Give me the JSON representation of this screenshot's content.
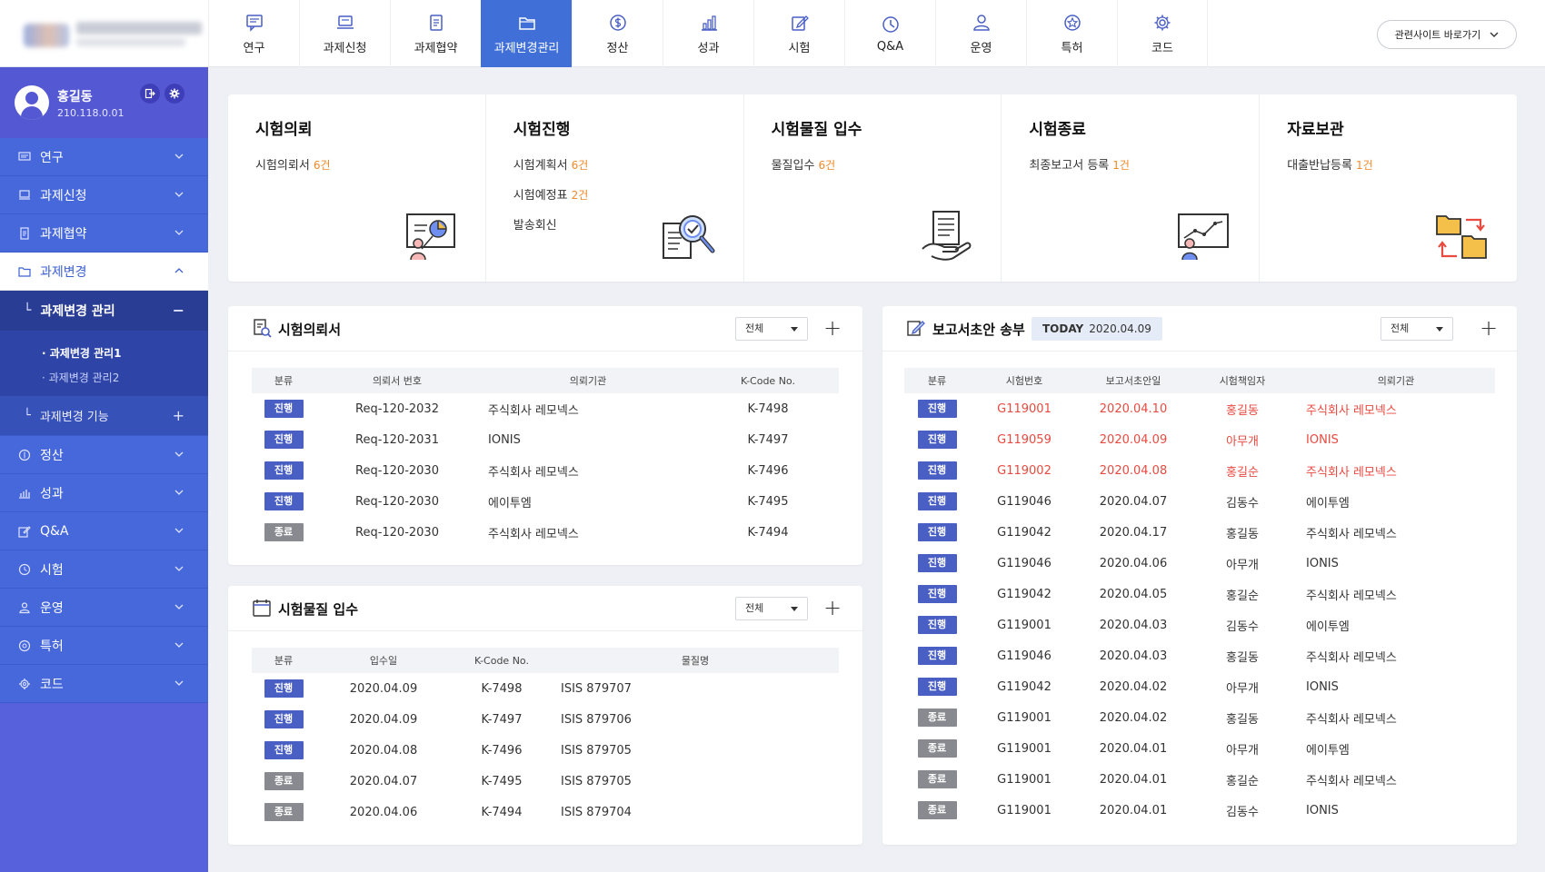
{
  "nav": [
    {
      "label": "연구",
      "icon": "chat-icon"
    },
    {
      "label": "과제신청",
      "icon": "laptop-icon"
    },
    {
      "label": "과제협약",
      "icon": "document-icon"
    },
    {
      "label": "과제변경관리",
      "icon": "folder-icon",
      "active": true
    },
    {
      "label": "정산",
      "icon": "dollar-icon"
    },
    {
      "label": "성과",
      "icon": "bar-chart-icon"
    },
    {
      "label": "시험",
      "icon": "edit-icon"
    },
    {
      "label": "Q&A",
      "icon": "clock-icon"
    },
    {
      "label": "운영",
      "icon": "person-icon"
    },
    {
      "label": "특허",
      "icon": "star-icon"
    },
    {
      "label": "코드",
      "icon": "gear-icon"
    }
  ],
  "related_site": "관련사이트 바로가기",
  "user": {
    "name": "홍길동",
    "ip": "210.118.0.01"
  },
  "sidebar": {
    "top_items": [
      "연구",
      "과제신청",
      "과제협약"
    ],
    "open_item": "과제변경",
    "sub_head": "과제변경 관리",
    "sub_items": [
      "과제변경 관리1",
      "과제변경 관리2"
    ],
    "sub_head2": "과제변경 기능",
    "bottom_items": [
      "정산",
      "성과",
      "Q&A",
      "시험",
      "운영",
      "특허",
      "코드"
    ]
  },
  "summary": [
    {
      "title": "시험의뢰",
      "lines": [
        {
          "label": "시험의뢰서",
          "count": "6건"
        }
      ]
    },
    {
      "title": "시험진행",
      "lines": [
        {
          "label": "시험계획서",
          "count": "6건"
        },
        {
          "label": "시험예정표",
          "count": "2건"
        },
        {
          "label": "발송회신",
          "count": ""
        }
      ]
    },
    {
      "title": "시험물질 입수",
      "lines": [
        {
          "label": "물질입수",
          "count": "6건"
        }
      ]
    },
    {
      "title": "시험종료",
      "lines": [
        {
          "label": "최종보고서 등록",
          "count": "1건"
        }
      ]
    },
    {
      "title": "자료보관",
      "lines": [
        {
          "label": "대출반납등록",
          "count": "1건"
        }
      ]
    }
  ],
  "request_panel": {
    "title": "시험의뢰서",
    "filter": "전체",
    "headers": [
      "분류",
      "의뢰서 번호",
      "의뢰기관",
      "K-Code No."
    ],
    "rows": [
      {
        "status": "진행",
        "no": "Req-120-2032",
        "org": "주식회사 레모넥스",
        "kcode": "K-7498"
      },
      {
        "status": "진행",
        "no": "Req-120-2031",
        "org": "IONIS",
        "kcode": "K-7497"
      },
      {
        "status": "진행",
        "no": "Req-120-2030",
        "org": "주식회사 레모넥스",
        "kcode": "K-7496"
      },
      {
        "status": "진행",
        "no": "Req-120-2030",
        "org": "에이투엠",
        "kcode": "K-7495"
      },
      {
        "status": "종료",
        "no": "Req-120-2030",
        "org": "주식회사 레모넥스",
        "kcode": "K-7494"
      }
    ]
  },
  "material_panel": {
    "title": "시험물질 입수",
    "filter": "전체",
    "headers": [
      "분류",
      "입수일",
      "K-Code No.",
      "물질명"
    ],
    "rows": [
      {
        "status": "진행",
        "date": "2020.04.09",
        "kcode": "K-7498",
        "name": "ISIS 879707"
      },
      {
        "status": "진행",
        "date": "2020.04.09",
        "kcode": "K-7497",
        "name": "ISIS 879706"
      },
      {
        "status": "진행",
        "date": "2020.04.08",
        "kcode": "K-7496",
        "name": "ISIS 879705"
      },
      {
        "status": "종료",
        "date": "2020.04.07",
        "kcode": "K-7495",
        "name": "ISIS 879705"
      },
      {
        "status": "종료",
        "date": "2020.04.06",
        "kcode": "K-7494",
        "name": "ISIS 879704"
      }
    ]
  },
  "report_panel": {
    "title": "보고서초안 송부",
    "today_label": "TODAY",
    "today_date": "2020.04.09",
    "filter": "전체",
    "headers": [
      "분류",
      "시험번호",
      "보고서초안일",
      "시험책임자",
      "의뢰기관"
    ],
    "rows": [
      {
        "status": "진행",
        "no": "G119001",
        "date": "2020.04.10",
        "manager": "홍길동",
        "org": "주식회사 레모넥스",
        "highlight": true
      },
      {
        "status": "진행",
        "no": "G119059",
        "date": "2020.04.09",
        "manager": "아무개",
        "org": "IONIS",
        "highlight": true
      },
      {
        "status": "진행",
        "no": "G119002",
        "date": "2020.04.08",
        "manager": "홍길순",
        "org": "주식회사 레모넥스",
        "highlight": true
      },
      {
        "status": "진행",
        "no": "G119046",
        "date": "2020.04.07",
        "manager": "김동수",
        "org": "에이투엠"
      },
      {
        "status": "진행",
        "no": "G119042",
        "date": "2020.04.17",
        "manager": "홍길동",
        "org": "주식회사 레모넥스"
      },
      {
        "status": "진행",
        "no": "G119046",
        "date": "2020.04.06",
        "manager": "아무개",
        "org": "IONIS"
      },
      {
        "status": "진행",
        "no": "G119042",
        "date": "2020.04.05",
        "manager": "홍길순",
        "org": "주식회사 레모넥스"
      },
      {
        "status": "진행",
        "no": "G119001",
        "date": "2020.04.03",
        "manager": "김동수",
        "org": "에이투엠"
      },
      {
        "status": "진행",
        "no": "G119046",
        "date": "2020.04.03",
        "manager": "홍길동",
        "org": "주식회사 레모넥스"
      },
      {
        "status": "진행",
        "no": "G119042",
        "date": "2020.04.02",
        "manager": "아무개",
        "org": "IONIS"
      },
      {
        "status": "종료",
        "no": "G119001",
        "date": "2020.04.02",
        "manager": "홍길동",
        "org": "주식회사 레모넥스"
      },
      {
        "status": "종료",
        "no": "G119001",
        "date": "2020.04.01",
        "manager": "아무개",
        "org": "에이투엠"
      },
      {
        "status": "종료",
        "no": "G119001",
        "date": "2020.04.01",
        "manager": "홍길순",
        "org": "주식회사 레모넥스"
      },
      {
        "status": "종료",
        "no": "G119001",
        "date": "2020.04.01",
        "manager": "김동수",
        "org": "IONIS"
      }
    ]
  }
}
